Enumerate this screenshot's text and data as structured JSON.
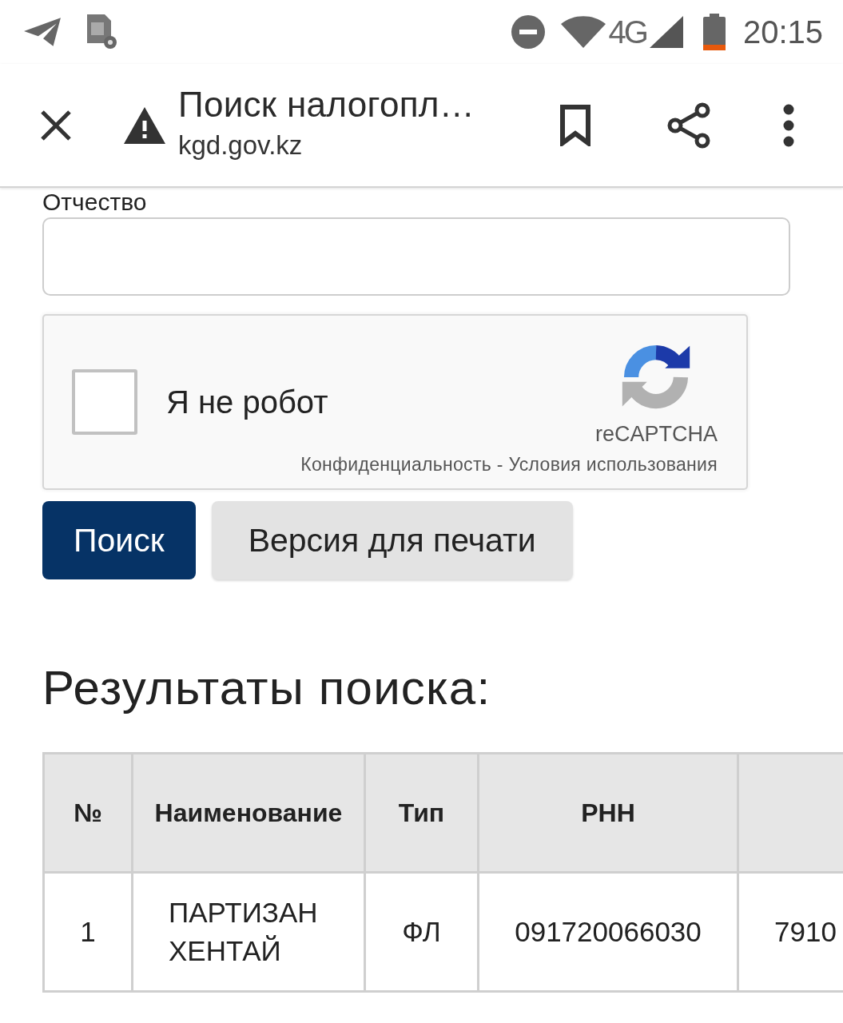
{
  "status_bar": {
    "network": "4G",
    "time": "20:15"
  },
  "toolbar": {
    "title": "Поиск налогопл…",
    "url": "kgd.gov.kz"
  },
  "form": {
    "fields": [
      {
        "label": "Отчество"
      }
    ],
    "recaptcha": {
      "checked": false,
      "label": "Я не робот",
      "brand": "reCAPTCHA",
      "privacy_link": "Конфиденциальность",
      "separator": "-",
      "terms_link": "Условия использования"
    },
    "buttons": [
      {
        "label": "Поиск",
        "kind": "primary"
      },
      {
        "label": "Версия для печати",
        "kind": "secondary"
      }
    ]
  },
  "results": {
    "heading": "Результаты поиска:",
    "table": {
      "columns": [
        "№",
        "Наименование",
        "Тип",
        "РНН"
      ],
      "rows": [
        {
          "cells": [
            "1",
            "ПАРТИЗАН ХЕНТАЙ",
            "ФЛ",
            "091720066030",
            "7910"
          ]
        }
      ]
    }
  }
}
